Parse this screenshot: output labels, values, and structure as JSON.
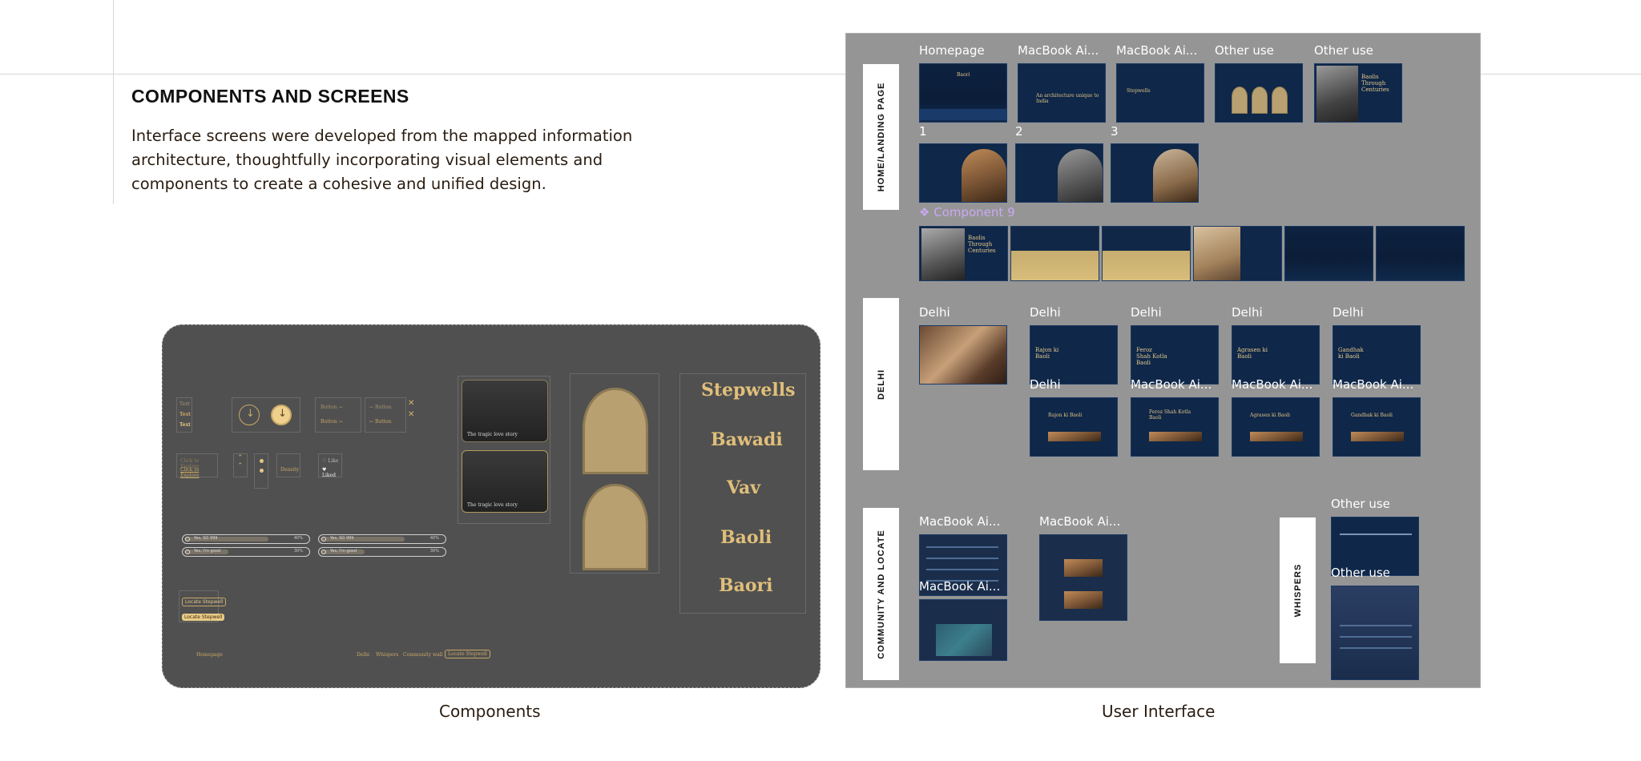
{
  "header": {
    "title": "COMPONENTS AND SCREENS",
    "description": "Interface screens were developed from the mapped information architecture, thoughtfully incorporating visual elements and components to create a cohesive and unified design."
  },
  "components_panel": {
    "caption": "Components",
    "text_styles": [
      "Text",
      "Text",
      "Text"
    ],
    "buttons": [
      "Button",
      "Button",
      "Button",
      "Button"
    ],
    "explore": [
      "Click to Explore",
      "Click to Explore"
    ],
    "filter": "Density",
    "like": [
      "Like",
      "Liked"
    ],
    "audio": [
      {
        "label": "Yes, SO 999",
        "pct": "40%"
      },
      {
        "label": "Yes, SO 999",
        "pct": "40%"
      },
      {
        "label": "Yes, I'm good",
        "pct": "30%"
      },
      {
        "label": "Yes, I'm good",
        "pct": "30%"
      }
    ],
    "locate": [
      "Locate Stepwell",
      "Locate Stepwell"
    ],
    "nav": {
      "home": "Homepage",
      "items": [
        "Delhi",
        "Whispers",
        "Community wall"
      ],
      "cta": "Locate Stepwell"
    },
    "cards": [
      "The tragic love story",
      "The tragic love story"
    ],
    "words": [
      "Stepwells",
      "Bawadi",
      "Vav",
      "Baoli",
      "Baori"
    ]
  },
  "ui_panel": {
    "caption": "User Interface",
    "sections": {
      "home": "HOME/LANDING PAGE",
      "delhi": "DELHI",
      "community": "COMMUNITY AND LOCATE",
      "whispers": "WHISPERS"
    },
    "home_labels": [
      "Homepage",
      "MacBook Ai...",
      "MacBook Ai...",
      "Other use",
      "Other use"
    ],
    "home_numbers": [
      "1",
      "2",
      "3"
    ],
    "component_label": "❖ Component 9",
    "delhi_labels_top": [
      "Delhi",
      "Delhi",
      "Delhi",
      "Delhi",
      "Delhi"
    ],
    "delhi_labels_bottom": [
      "Delhi",
      "MacBook Ai...",
      "MacBook Ai...",
      "MacBook Ai..."
    ],
    "community_labels": [
      "MacBook Ai...",
      "MacBook Ai...",
      "MacBook Ai..."
    ],
    "whispers_labels": [
      "Other use",
      "Other use"
    ],
    "thumb_text": {
      "baoli": "Baori",
      "tagline": "An architecture unique to India",
      "stepwells": "Stepwells",
      "through": "Baolis Through Centuries",
      "rajon": "Rajon ki Baoli",
      "ferozshah": "Feroz Shah Kotla Baoli",
      "agrasen": "Agrasen ki Baoli",
      "gandhak": "Gandhak ki Baoli"
    }
  },
  "colors": {
    "panel_dark": "#505050",
    "panel_grey": "#959595",
    "gold": "#d9b36a",
    "navy": "#0f2748",
    "accent_purple": "#c9a9f2"
  }
}
